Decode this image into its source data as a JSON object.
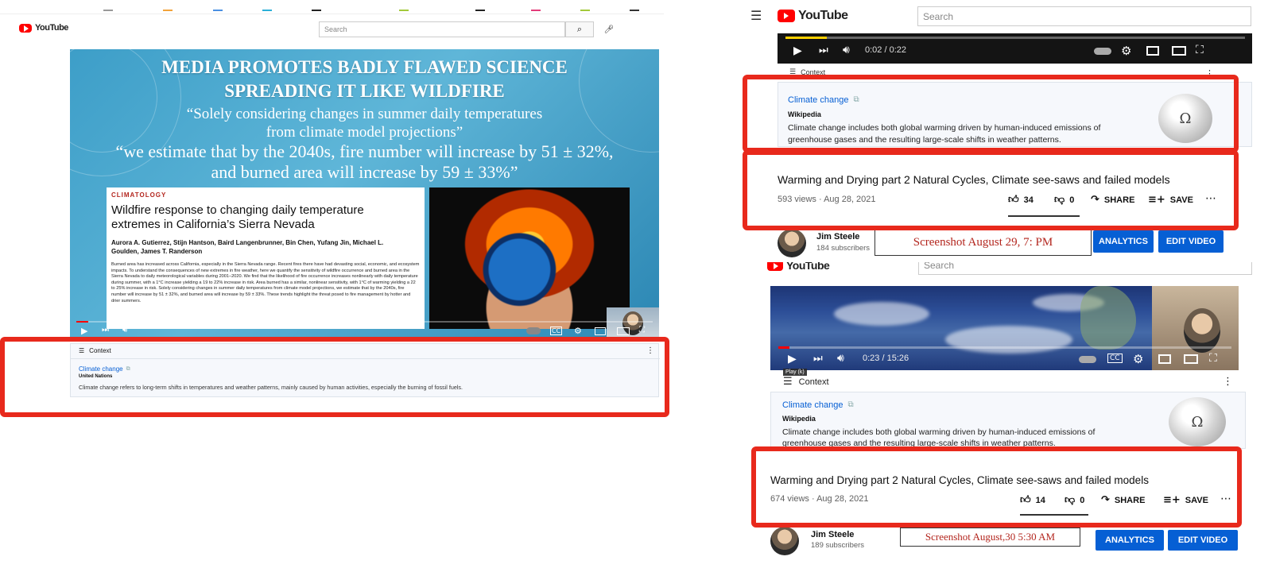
{
  "left": {
    "logo": "YouTube",
    "search_placeholder": "Search",
    "slide": {
      "title_line1": "MEDIA PROMOTES BADLY FLAWED SCIENCE",
      "title_line2": "SPREADING IT LIKE WILDFIRE",
      "quote1_line1": "“Solely considering changes in summer daily temperatures",
      "quote1_line2": "from climate model projections”",
      "quote2_line1": "“we estimate that by the 2040s, fire number will increase by 51 ± 32%,",
      "quote2_line2": "and burned area will increase by 59 ± 33%”",
      "paper": {
        "section": "CLIMATOLOGY",
        "title": "Wildfire response to changing daily temperature extremes in California’s Sierra Nevada",
        "authors": "Aurora A. Gutierrez, Stijn Hantson, Baird Langenbrunner, Bin Chen, Yufang Jin, Michael L. Goulden, James T. Randerson",
        "abstract": "Burned area has increased across California, especially in the Sierra Nevada range. Recent fires there have had devasting social, economic, and ecosystem impacts. To understand the consequences of new extremes in fire weather, here we quantify the sensitivity of wildfire occurrence and burned area in the Sierra Nevada to daily meteorological variables during 2001–2020. We find that the likelihood of fire occurrence increases nonlinearly with daily temperature during summer, with a 1°C increase yielding a 19 to 22% increase in risk. Area burned has a similar, nonlinear sensitivity, with 1°C of warming yielding a 22 to 25% increase in risk. Solely considering changes in summer daily temperatures from climate model projections, we estimate that by the 2040s, fire number will increase by 51 ± 32%, and burned area will increase by 59 ± 33%. These trends highlight the threat posed to fire management by hotter and drier summers."
      }
    },
    "context": {
      "header": "Context",
      "link": "Climate change",
      "source": "United Nations",
      "text": "Climate change refers to long-term shifts in temperatures and weather patterns, mainly caused by human activities, especially the burning of fossil fuels."
    }
  },
  "right_top": {
    "logo": "YouTube",
    "search_placeholder": "Search",
    "time": "0:02 / 0:22",
    "progress": 0.09,
    "context": {
      "header": "Context",
      "link": "Climate change",
      "source": "Wikipedia",
      "text_line1": "Climate change includes both global warming driven by human-induced emissions of",
      "text_line2": "greenhouse gases and the resulting large-scale shifts in weather patterns."
    },
    "video_title": "Warming and Drying part 2 Natural Cycles, Climate see-saws and failed models",
    "meta": "593 views · Aug 28, 2021",
    "likes": "34",
    "dislikes": "0",
    "share": "SHARE",
    "save": "SAVE",
    "channel": "Jim Steele",
    "subscribers": "184 subscribers",
    "note": "Screenshot August 29, 7: PM",
    "analytics": "ANALYTICS",
    "edit": "EDIT VIDEO"
  },
  "right_bottom": {
    "logo": "YouTube",
    "search_placeholder": "Search",
    "time": "0:23 / 15:26",
    "progress": 0.025,
    "tooltip": "Play (k)",
    "context": {
      "header": "Context",
      "link": "Climate change",
      "source": "Wikipedia",
      "text_line1": "Climate change includes both global warming driven by human-induced emissions of",
      "text_line2": "greenhouse gases and the resulting large-scale shifts in weather patterns."
    },
    "video_title": "Warming and Drying part 2 Natural Cycles, Climate see-saws and failed models",
    "meta": "674 views · Aug 28, 2021",
    "likes": "14",
    "dislikes": "0",
    "share": "SHARE",
    "save": "SAVE",
    "channel": "Jim Steele",
    "subscribers": "189 subscribers",
    "note": "Screenshot August,30 5:30 AM",
    "analytics": "ANALYTICS",
    "edit": "EDIT VIDEO"
  },
  "colors": {
    "highlight_red": "#e8291c",
    "youtube_red": "#ff0000",
    "link_blue": "#065fd4",
    "button_blue": "#065fd4",
    "note_red": "#b3261e"
  },
  "icons": [
    "play-icon",
    "next-icon",
    "volume-icon",
    "autoplay-toggle-icon",
    "captions-icon",
    "settings-icon",
    "miniplayer-icon",
    "theater-icon",
    "fullscreen-icon",
    "search-icon",
    "mic-icon",
    "menu-icon",
    "like-icon",
    "dislike-icon",
    "share-icon",
    "save-icon",
    "more-icon",
    "external-link-icon",
    "wikipedia-globe-icon",
    "context-icon"
  ]
}
